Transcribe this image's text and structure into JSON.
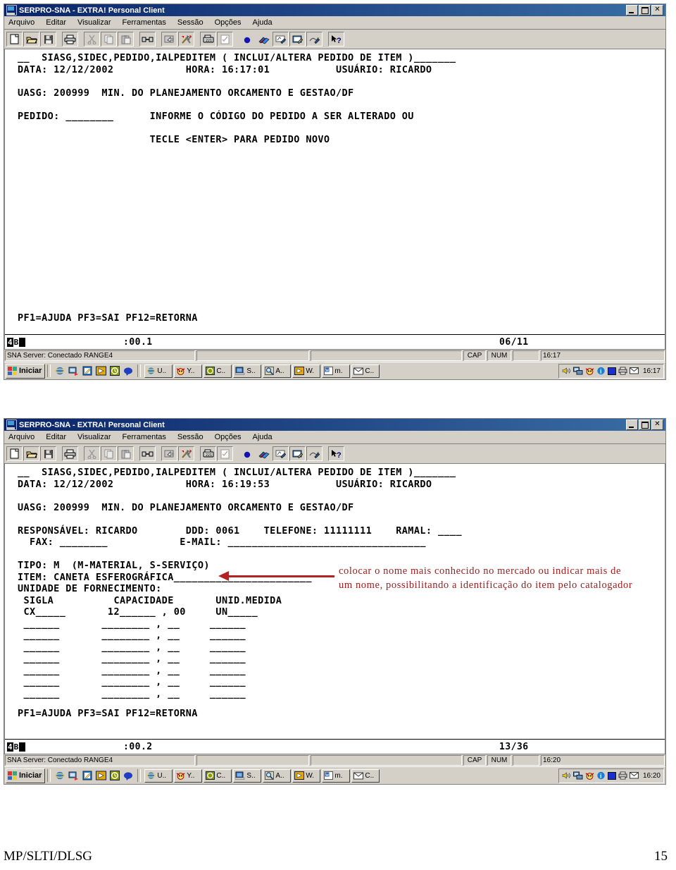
{
  "window": {
    "title": "SERPRO-SNA - EXTRA! Personal Client",
    "menu": [
      "Arquivo",
      "Editar",
      "Visualizar",
      "Ferramentas",
      "Sessão",
      "Opções",
      "Ajuda"
    ],
    "buttons": {
      "minimize": "_",
      "maximize": "□",
      "close": "✕"
    },
    "toolbar_icons": [
      "new-document-icon",
      "open-folder-icon",
      "save-disk-icon",
      "print-icon",
      "cut-scissors-icon",
      "copy-icon",
      "paste-icon",
      "connect-icon",
      "file-transfer-icon",
      "tools-icon",
      "fax-icon",
      "checklist-icon",
      "record-dot-icon",
      "books-icon",
      "macro-record-icon",
      "macro-edit-icon",
      "macro-run-icon",
      "help-pointer-icon"
    ]
  },
  "screen1": {
    "lines": [
      "__  SIASG,SIDEC,PEDIDO,IALPEDITEM ( INCLUI/ALTERA PEDIDO DE ITEM )_______",
      "DATA: 12/12/2002            HORA: 16:17:01           USUÁRIO: RICARDO",
      "",
      "UASG: 200999  MIN. DO PLANEJAMENTO ORCAMENTO E GESTAO/DF",
      "",
      "PEDIDO: ________      INFORME O CÓDIGO DO PEDIDO A SER ALTERADO OU",
      "",
      "                      TECLE <ENTER> PARA PEDIDO NOVO"
    ],
    "function_keys": "PF1=AJUDA PF3=SAI PF12=RETORNA",
    "oia": {
      "indicator": "4B",
      "clock": ":00.1",
      "position": "06/11"
    },
    "status": {
      "connection": "SNA Server: Conectado RANGE4",
      "cap": "CAP",
      "num": "NUM",
      "time": "16:17"
    }
  },
  "screen2": {
    "lines": [
      "__  SIASG,SIDEC,PEDIDO,IALPEDITEM ( INCLUI/ALTERA PEDIDO DE ITEM )_______",
      "DATA: 12/12/2002            HORA: 16:19:53           USUÁRIO: RICARDO",
      "",
      "UASG: 200999  MIN. DO PLANEJAMENTO ORCAMENTO E GESTAO/DF",
      "",
      "RESPONSÁVEL: RICARDO        DDD: 0061    TELEFONE: 11111111    RAMAL: ____",
      "  FAX: ________            E-MAIL: _________________________________",
      "",
      "TIPO: M  (M-MATERIAL, S-SERVIÇO)",
      "ITEM: CANETA ESFEROGRÁFICA_______________________",
      "UNIDADE DE FORNECIMENTO:",
      " SIGLA          CAPACIDADE       UNID.MEDIDA",
      " CX_____       12______ , 00     UN_____"
    ],
    "empty_rows": 7,
    "empty_row_template": " ______       ________ , __     ______",
    "function_keys": "PF1=AJUDA PF3=SAI PF12=RETORNA",
    "oia": {
      "indicator": "4B",
      "clock": ":00.2",
      "position": "13/36"
    },
    "status": {
      "connection": "SNA Server: Conectado RANGE4",
      "cap": "CAP",
      "num": "NUM",
      "time": "16:20"
    }
  },
  "annotation": {
    "text": "colocar o nome mais conhecido no mercado ou indicar mais de um nome, possibilitando a identificação do item pelo catalogador",
    "color": "#9e1b1b",
    "arrow_color": "#b22222"
  },
  "taskbar": {
    "start_label": "Iniciar",
    "quick_launch": [
      "internet-explorer-icon",
      "show-desktop-icon",
      "outlook-express-icon",
      "media-player-icon",
      "clock-green-icon",
      "messenger-icon"
    ],
    "tasks1": [
      "U..",
      "Y..",
      "C..",
      "S..",
      "A..",
      "W.",
      "m.",
      "C.."
    ],
    "tasks2": [
      "U..",
      "Y..",
      "C..",
      "S..",
      "A..",
      "W.",
      "m.",
      "C.."
    ],
    "tray_icons": [
      "volume-icon",
      "network-icon",
      "yahoo-icon",
      "info-icon",
      "blue-square-icon",
      "printer-icon",
      "mail-icon"
    ],
    "clock1": "16:17",
    "clock2": "16:20"
  },
  "footer": {
    "left": "MP/SLTI/DLSG",
    "page": "15"
  }
}
